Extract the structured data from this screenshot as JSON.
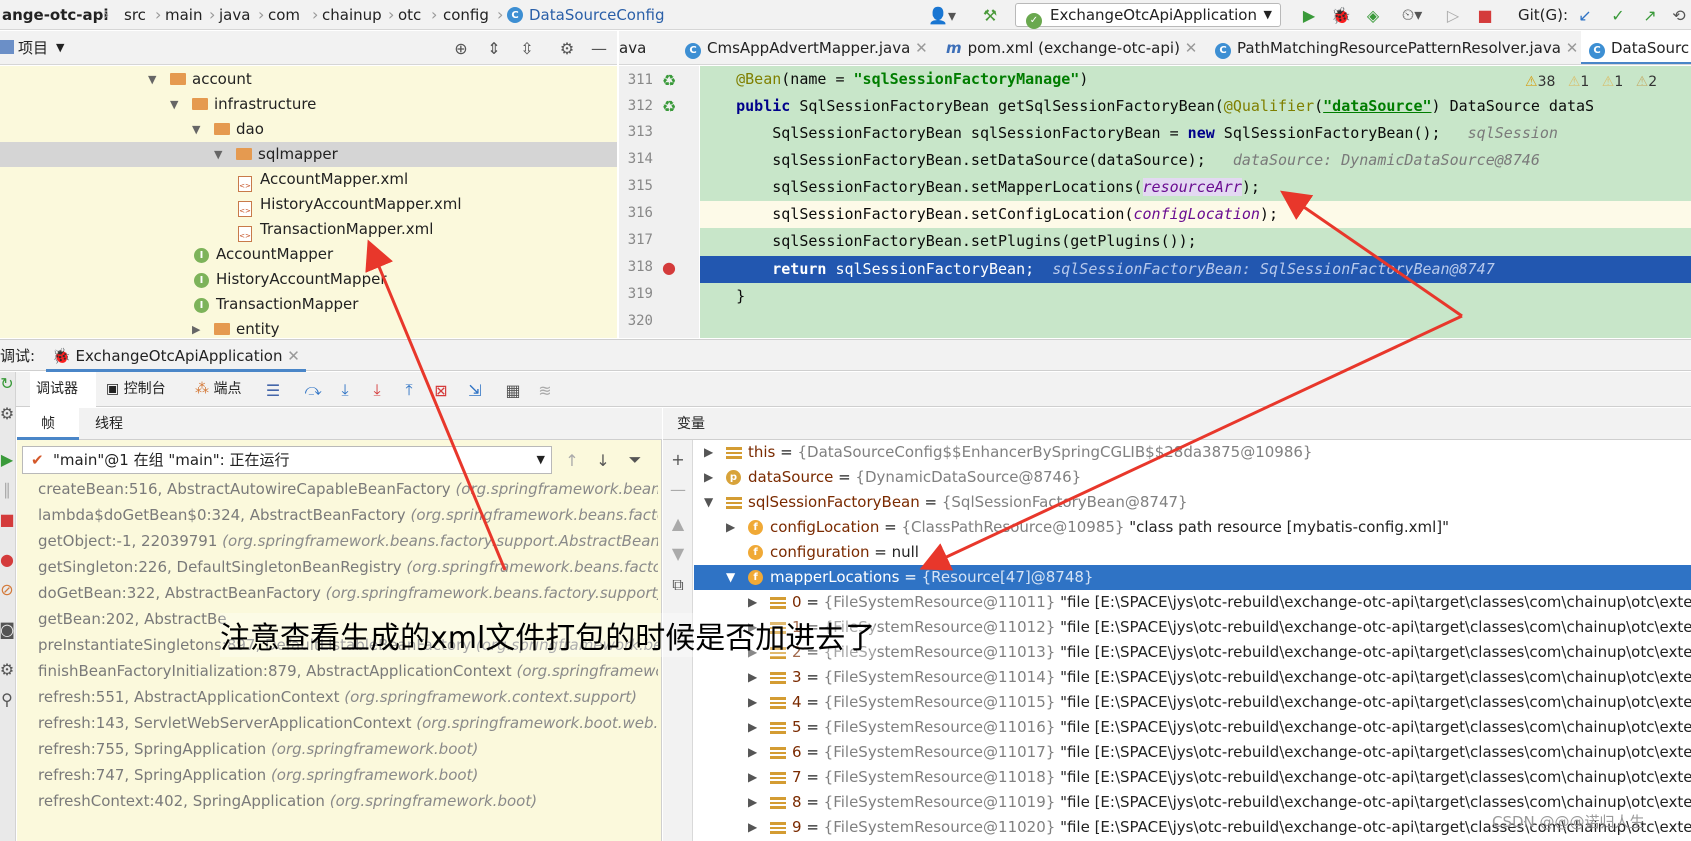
{
  "breadcrumb": {
    "project": "ange-otc-api",
    "segments": [
      "src",
      "main",
      "java",
      "com",
      "chainup",
      "otc",
      "config"
    ],
    "current": "DataSourceConfig"
  },
  "toolbar": {
    "run_config": "ExchangeOtcApiApplication",
    "git_label": "Git(G):"
  },
  "project_panel": {
    "title": "项目"
  },
  "editor_tabs": [
    "ava",
    "CmsAppAdvertMapper.java",
    "pom.xml (exchange-otc-api)",
    "PathMatchingResourcePatternResolver.java",
    "DataSourc"
  ],
  "inspections": {
    "warnings": "38",
    "weak1": "1",
    "weak2": "1",
    "info": "2"
  },
  "tree": [
    {
      "label": "account",
      "type": "folder",
      "level": 1,
      "expanded": true
    },
    {
      "label": "infrastructure",
      "type": "folder",
      "level": 2,
      "expanded": true
    },
    {
      "label": "dao",
      "type": "folder",
      "level": 3,
      "expanded": true
    },
    {
      "label": "sqlmapper",
      "type": "folder",
      "level": 4,
      "expanded": true,
      "selected": true
    },
    {
      "label": "AccountMapper.xml",
      "type": "xml",
      "level": 5
    },
    {
      "label": "HistoryAccountMapper.xml",
      "type": "xml",
      "level": 5
    },
    {
      "label": "TransactionMapper.xml",
      "type": "xml",
      "level": 5
    },
    {
      "label": "AccountMapper",
      "type": "interface",
      "level": 4
    },
    {
      "label": "HistoryAccountMapper",
      "type": "interface",
      "level": 4
    },
    {
      "label": "TransactionMapper",
      "type": "interface",
      "level": 4
    },
    {
      "label": "entity",
      "type": "folder",
      "level": 3,
      "expanded": false
    }
  ],
  "code": {
    "lines": [
      "311",
      "312",
      "313",
      "314",
      "315",
      "316",
      "317",
      "318",
      "319",
      "320"
    ],
    "l311": {
      "an": "@Bean",
      "p1": "(name = ",
      "s": "\"sqlSessionFactoryManage\"",
      "p2": ")"
    },
    "l312": {
      "kw": "public",
      "t1": " SqlSessionFactoryBean getSqlSessionFactoryBean(",
      "an": "@Qualifier",
      "t2": "(",
      "s": "\"dataSource\"",
      "t3": ") DataSource dataS"
    },
    "l313": {
      "t1": "    SqlSessionFactoryBean sqlSessionFactoryBean = ",
      "kw": "new",
      "t2": " SqlSessionFactoryBean();",
      "h": "   sqlSession"
    },
    "l314": {
      "t1": "    sqlSessionFactoryBean.setDataSource(dataSource);",
      "h": "   dataSource: DynamicDataSource@8746"
    },
    "l315": {
      "t1": "    sqlSessionFactoryBean.setMapperLocations(",
      "f": "resourceArr",
      "t2": ");"
    },
    "l316": {
      "t1": "    sqlSessionFactoryBean.setConfigLocation(",
      "f": "configLocation",
      "t2": ");"
    },
    "l317": {
      "t1": "    sqlSessionFactoryBean.setPlugins(getPlugins());"
    },
    "l318": {
      "t1": "    ",
      "kw": "return",
      "t2": " sqlSessionFactoryBean;",
      "h": "  sqlSessionFactoryBean: SqlSessionFactoryBean@8747"
    },
    "l319": {
      "t1": "}"
    }
  },
  "debug": {
    "label": "调试:",
    "session": "ExchangeOtcApiApplication",
    "tabs": {
      "debugger": "调试器",
      "console": "控制台",
      "breakpoints": "端点"
    },
    "frames_tab": "帧",
    "threads_tab": "线程",
    "variables_tab": "变量",
    "thread_selector": "\"main\"@1 在组 \"main\": 正在运行",
    "frames": [
      {
        "m": "createBean:516, AbstractAutowireCapableBeanFactory",
        "p": "(org.springframework.beans.fa"
      },
      {
        "m": "lambda$doGetBean$0:324, AbstractBeanFactory",
        "p": "(org.springframework.beans.factory."
      },
      {
        "m": "getObject:-1, 22039791",
        "p": "(org.springframework.beans.factory.support.AbstractBeanFac"
      },
      {
        "m": "getSingleton:226, DefaultSingletonBeanRegistry",
        "p": "(org.springframework.beans.factory."
      },
      {
        "m": "doGetBean:322, AbstractBeanFactory",
        "p": "(org.springframework.beans.factory.support)"
      },
      {
        "m": "getBean:202, AbstractBe",
        "p": ""
      },
      {
        "m": "preInstantiateSingletons:897, DefaultListableBeanFactory",
        "p": "(org.springframework.beans"
      },
      {
        "m": "finishBeanFactoryInitialization:879, AbstractApplicationContext",
        "p": "(org.springframework."
      },
      {
        "m": "refresh:551, AbstractApplicationContext",
        "p": "(org.springframework.context.support)"
      },
      {
        "m": "refresh:143, ServletWebServerApplicationContext",
        "p": "(org.springframework.boot.web.se"
      },
      {
        "m": "refresh:755, SpringApplication",
        "p": "(org.springframework.boot)"
      },
      {
        "m": "refresh:747, SpringApplication",
        "p": "(org.springframework.boot)"
      },
      {
        "m": "refreshContext:402, SpringApplication",
        "p": "(org.springframework.boot)"
      }
    ],
    "vars": [
      {
        "name": "this",
        "val": "{DataSourceConfig$$EnhancerBySpringCGLIB$$28da3875@10986}",
        "extra": "",
        "icon": "lines",
        "lvl": 0,
        "exp": "▶"
      },
      {
        "name": "dataSource",
        "val": "{DynamicDataSource@8746}",
        "extra": "",
        "icon": "p",
        "lvl": 0,
        "exp": "▶"
      },
      {
        "name": "sqlSessionFactoryBean",
        "val": "{SqlSessionFactoryBean@8747}",
        "extra": "",
        "icon": "lines",
        "lvl": 0,
        "exp": "▼"
      },
      {
        "name": "configLocation",
        "val": "{ClassPathResource@10985}",
        "extra": " \"class path resource [mybatis-config.xml]\"",
        "icon": "f",
        "lvl": 1,
        "exp": "▶"
      },
      {
        "name": "configuration",
        "val": "",
        "extra": "null",
        "icon": "f",
        "lvl": 1,
        "exp": ""
      },
      {
        "name": "mapperLocations",
        "val": "{Resource[47]@8748}",
        "extra": "",
        "icon": "f",
        "lvl": 1,
        "exp": "▼",
        "sel": true
      },
      {
        "name": "0",
        "val": "{FileSystemResource@11011}",
        "extra": " \"file [E:\\SPACE\\jys\\otc-rebuild\\exchange-otc-api\\target\\classes\\com\\chainup\\otc\\externa",
        "icon": "lines",
        "lvl": 2,
        "exp": "▶"
      },
      {
        "name": "1",
        "val": "{FileSystemResource@11012}",
        "extra": " \"file [E:\\SPACE\\jys\\otc-rebuild\\exchange-otc-api\\target\\classes\\com\\chainup\\otc\\externa",
        "icon": "lines",
        "lvl": 2,
        "exp": "▶"
      },
      {
        "name": "2",
        "val": "{FileSystemResource@11013}",
        "extra": " \"file [E:\\SPACE\\jys\\otc-rebuild\\exchange-otc-api\\target\\classes\\com\\chainup\\otc\\externa",
        "icon": "lines",
        "lvl": 2,
        "exp": "▶"
      },
      {
        "name": "3",
        "val": "{FileSystemResource@11014}",
        "extra": " \"file [E:\\SPACE\\jys\\otc-rebuild\\exchange-otc-api\\target\\classes\\com\\chainup\\otc\\externa",
        "icon": "lines",
        "lvl": 2,
        "exp": "▶"
      },
      {
        "name": "4",
        "val": "{FileSystemResource@11015}",
        "extra": " \"file [E:\\SPACE\\jys\\otc-rebuild\\exchange-otc-api\\target\\classes\\com\\chainup\\otc\\externa",
        "icon": "lines",
        "lvl": 2,
        "exp": "▶"
      },
      {
        "name": "5",
        "val": "{FileSystemResource@11016}",
        "extra": " \"file [E:\\SPACE\\jys\\otc-rebuild\\exchange-otc-api\\target\\classes\\com\\chainup\\otc\\externa",
        "icon": "lines",
        "lvl": 2,
        "exp": "▶"
      },
      {
        "name": "6",
        "val": "{FileSystemResource@11017}",
        "extra": " \"file [E:\\SPACE\\jys\\otc-rebuild\\exchange-otc-api\\target\\classes\\com\\chainup\\otc\\externa",
        "icon": "lines",
        "lvl": 2,
        "exp": "▶"
      },
      {
        "name": "7",
        "val": "{FileSystemResource@11018}",
        "extra": " \"file [E:\\SPACE\\jys\\otc-rebuild\\exchange-otc-api\\target\\classes\\com\\chainup\\otc\\externa",
        "icon": "lines",
        "lvl": 2,
        "exp": "▶"
      },
      {
        "name": "8",
        "val": "{FileSystemResource@11019}",
        "extra": " \"file [E:\\SPACE\\jys\\otc-rebuild\\exchange-otc-api\\target\\classes\\com\\chainup\\otc\\externa",
        "icon": "lines",
        "lvl": 2,
        "exp": "▶"
      },
      {
        "name": "9",
        "val": "{FileSystemResource@11020}",
        "extra": " \"file [E:\\SPACE\\jys\\otc-rebuild\\exchange-otc-api\\target\\classes\\com\\chainup\\otc\\externa",
        "icon": "lines",
        "lvl": 2,
        "exp": "▶"
      }
    ]
  },
  "annotation": "注意查看生成的xml文件打包的时候是否加进去了",
  "watermark": "CSDN @@@诺归人生",
  "colors": {
    "code_bg": "#c8e6c9",
    "selection": "#2257b0",
    "panel_bg": "#fbf9dc",
    "arrow": "#e8372b"
  }
}
